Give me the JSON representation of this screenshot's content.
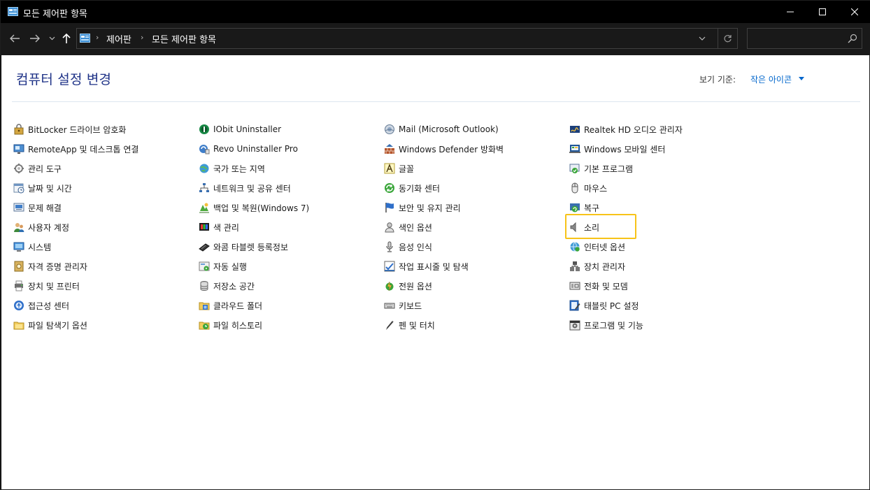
{
  "window": {
    "title": "모든 제어판 항목",
    "minimize": "—",
    "maximize": "☐",
    "close": "✕"
  },
  "nav": {
    "back": "←",
    "forward": "→",
    "recent": "⌄",
    "up": "↑"
  },
  "address": {
    "separator": "›",
    "crumbs": [
      "제어판",
      "모든 제어판 항목"
    ]
  },
  "search": {
    "placeholder": ""
  },
  "main": {
    "heading": "컴퓨터 설정 변경",
    "view_by_label": "보기 기준:",
    "view_by_value": "작은 아이콘"
  },
  "columns": [
    [
      {
        "label": "BitLocker 드라이브 암호화",
        "icon": "bitlocker-icon"
      },
      {
        "label": "RemoteApp 및 데스크톱 연결",
        "icon": "remoteapp-icon"
      },
      {
        "label": "관리 도구",
        "icon": "admin-tools-icon"
      },
      {
        "label": "날짜 및 시간",
        "icon": "datetime-icon"
      },
      {
        "label": "문제 해결",
        "icon": "troubleshoot-icon"
      },
      {
        "label": "사용자 계정",
        "icon": "user-accounts-icon"
      },
      {
        "label": "시스템",
        "icon": "system-icon"
      },
      {
        "label": "자격 증명 관리자",
        "icon": "credential-icon"
      },
      {
        "label": "장치 및 프린터",
        "icon": "devices-printers-icon"
      },
      {
        "label": "접근성 센터",
        "icon": "accessibility-icon"
      },
      {
        "label": "파일 탐색기 옵션",
        "icon": "folder-options-icon"
      }
    ],
    [
      {
        "label": "IObit Uninstaller",
        "icon": "iobit-icon"
      },
      {
        "label": "Revo Uninstaller Pro",
        "icon": "revo-icon"
      },
      {
        "label": "국가 또는 지역",
        "icon": "region-icon"
      },
      {
        "label": "네트워크 및 공유 센터",
        "icon": "network-icon"
      },
      {
        "label": "백업 및 복원(Windows 7)",
        "icon": "backup-icon"
      },
      {
        "label": "색 관리",
        "icon": "color-management-icon"
      },
      {
        "label": "와콤 타블렛 등록정보",
        "icon": "wacom-icon"
      },
      {
        "label": "자동 실행",
        "icon": "autoplay-icon"
      },
      {
        "label": "저장소 공간",
        "icon": "storage-icon"
      },
      {
        "label": "클라우드 폴더",
        "icon": "cloud-folder-icon"
      },
      {
        "label": "파일 히스토리",
        "icon": "file-history-icon"
      }
    ],
    [
      {
        "label": "Mail (Microsoft Outlook)",
        "icon": "mail-icon"
      },
      {
        "label": "Windows Defender 방화벽",
        "icon": "firewall-icon"
      },
      {
        "label": "글꼴",
        "icon": "fonts-icon"
      },
      {
        "label": "동기화 센터",
        "icon": "sync-icon"
      },
      {
        "label": "보안 및 유지 관리",
        "icon": "security-flag-icon"
      },
      {
        "label": "색인 옵션",
        "icon": "indexing-icon"
      },
      {
        "label": "음성 인식",
        "icon": "speech-icon"
      },
      {
        "label": "작업 표시줄 및 탐색",
        "icon": "taskbar-icon"
      },
      {
        "label": "전원 옵션",
        "icon": "power-icon"
      },
      {
        "label": "키보드",
        "icon": "keyboard-icon"
      },
      {
        "label": "펜 및 터치",
        "icon": "pen-icon"
      }
    ],
    [
      {
        "label": "Realtek HD 오디오 관리자",
        "icon": "realtek-icon"
      },
      {
        "label": "Windows 모바일 센터",
        "icon": "mobility-icon"
      },
      {
        "label": "기본 프로그램",
        "icon": "default-programs-icon"
      },
      {
        "label": "마우스",
        "icon": "mouse-icon"
      },
      {
        "label": "복구",
        "icon": "recovery-icon"
      },
      {
        "label": "소리",
        "icon": "sound-icon"
      },
      {
        "label": "인터넷 옵션",
        "icon": "internet-options-icon"
      },
      {
        "label": "장치 관리자",
        "icon": "device-manager-icon"
      },
      {
        "label": "전화 및 모뎀",
        "icon": "phone-modem-icon"
      },
      {
        "label": "태블릿 PC 설정",
        "icon": "tablet-icon"
      },
      {
        "label": "프로그램 및 기능",
        "icon": "programs-features-icon"
      }
    ]
  ],
  "highlighted_item": "소리",
  "colors": {
    "heading": "#1e3287",
    "link": "#0066cc",
    "highlight": "#f7c319"
  }
}
